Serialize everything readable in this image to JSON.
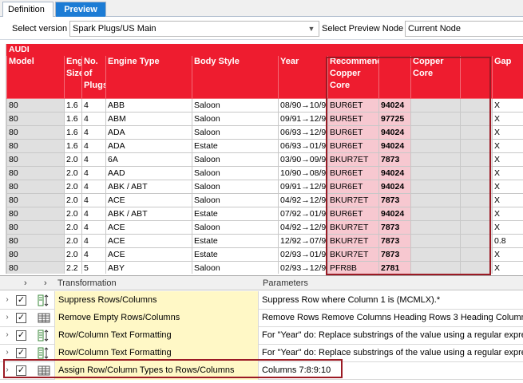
{
  "tabs": [
    {
      "label": "Definition"
    },
    {
      "label": "Preview"
    }
  ],
  "toolbar": {
    "version_label": "Select version",
    "version_value": "Spark Plugs/US Main",
    "node_label": "Select Preview Node",
    "node_value": "Current Node"
  },
  "grid": {
    "title": "AUDI",
    "columns": [
      "Model",
      "Engine Size",
      "No. of Plugs",
      "Engine Type",
      "Body Style",
      "Year",
      "Recommended Copper Core",
      "",
      "Copper Core",
      "",
      "Gap"
    ],
    "rows": [
      [
        "80",
        "1.6",
        "4",
        "ABB",
        "Saloon",
        "08/90→10/9",
        "BUR6ET",
        "94024",
        "",
        "",
        "X"
      ],
      [
        "80",
        "1.6",
        "4",
        "ABM",
        "Saloon",
        "09/91→12/9",
        "BUR5ET",
        "97725",
        "",
        "",
        "X"
      ],
      [
        "80",
        "1.6",
        "4",
        "ADA",
        "Saloon",
        "06/93→12/9",
        "BUR6ET",
        "94024",
        "",
        "",
        "X"
      ],
      [
        "80",
        "1.6",
        "4",
        "ADA",
        "Estate",
        "06/93→01/9",
        "BUR6ET",
        "94024",
        "",
        "",
        "X"
      ],
      [
        "80",
        "2.0",
        "4",
        "6A",
        "Saloon",
        "03/90→09/9",
        "BKUR7ET",
        "7873",
        "",
        "",
        "X"
      ],
      [
        "80",
        "2.0",
        "4",
        "AAD",
        "Saloon",
        "10/90→08/9",
        "BUR6ET",
        "94024",
        "",
        "",
        "X"
      ],
      [
        "80",
        "2.0",
        "4",
        "ABK / ABT",
        "Saloon",
        "09/91→12/9",
        "BUR6ET",
        "94024",
        "",
        "",
        "X"
      ],
      [
        "80",
        "2.0",
        "4",
        "ACE",
        "Saloon",
        "04/92→12/9",
        "BKUR7ET",
        "7873",
        "",
        "",
        "X"
      ],
      [
        "80",
        "2.0",
        "4",
        "ABK / ABT",
        "Estate",
        "07/92→01/9",
        "BUR6ET",
        "94024",
        "",
        "",
        "X"
      ],
      [
        "80",
        "2.0",
        "4",
        "ACE",
        "Saloon",
        "04/92→12/9",
        "BKUR7ET",
        "7873",
        "",
        "",
        "X"
      ],
      [
        "80",
        "2.0",
        "4",
        "ACE",
        "Estate",
        "12/92→07/9",
        "BKUR7ET",
        "7873",
        "",
        "",
        "0.8"
      ],
      [
        "80",
        "2.0",
        "4",
        "ACE",
        "Estate",
        "02/93→01/9",
        "BKUR7ET",
        "7873",
        "",
        "",
        "X"
      ],
      [
        "80",
        "2.2",
        "5",
        "ABY",
        "Saloon",
        "02/93→12/9",
        "PFR8B",
        "2781",
        "",
        "",
        "X"
      ]
    ]
  },
  "transformations": {
    "header_transformation": "Transformation",
    "header_parameters": "Parameters",
    "items": [
      {
        "name": "Suppress Rows/Columns",
        "params": "Suppress Row where Column 1 is (MCMLX).*",
        "checked": true,
        "icon": "suppress-icon"
      },
      {
        "name": "Remove Empty Rows/Columns",
        "params": "Remove Rows Remove Columns Heading Rows 3 Heading Columns 0",
        "checked": true,
        "icon": "table-icon"
      },
      {
        "name": "Row/Column Text Formatting",
        "params": "For \"Year\" do: Replace substrings of the value using a regular expre",
        "checked": true,
        "icon": "text-format-icon"
      },
      {
        "name": "Row/Column Text Formatting",
        "params": "For \"Year\" do: Replace substrings of the value using a regular expre",
        "checked": true,
        "icon": "text-format-icon"
      },
      {
        "name": "Assign Row/Column Types to Rows/Columns",
        "params": "Columns 7:8:9:10",
        "checked": true,
        "icon": "table-icon"
      }
    ]
  },
  "colors": {
    "accent": "#1c7cd5",
    "brand_red": "#ee1c2f",
    "highlight_box": "#9b1a24"
  }
}
